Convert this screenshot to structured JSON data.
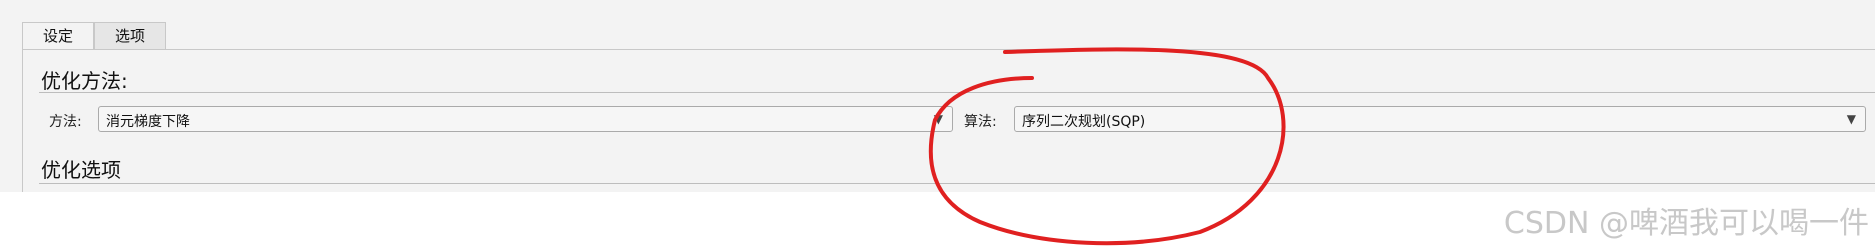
{
  "tabs": [
    {
      "label": "设定"
    },
    {
      "label": "选项"
    }
  ],
  "sections": [
    {
      "title": "优化方法:"
    },
    {
      "title": "优化选项"
    }
  ],
  "method": {
    "label": "方法:",
    "value": "消元梯度下降"
  },
  "algorithm": {
    "label": "算法:",
    "value": "序列二次规划(SQP)"
  },
  "annotation": {
    "color": "#e02020"
  },
  "watermark": "CSDN @啤酒我可以喝一件",
  "icons": {
    "dropdown": "chevron-down-icon"
  }
}
